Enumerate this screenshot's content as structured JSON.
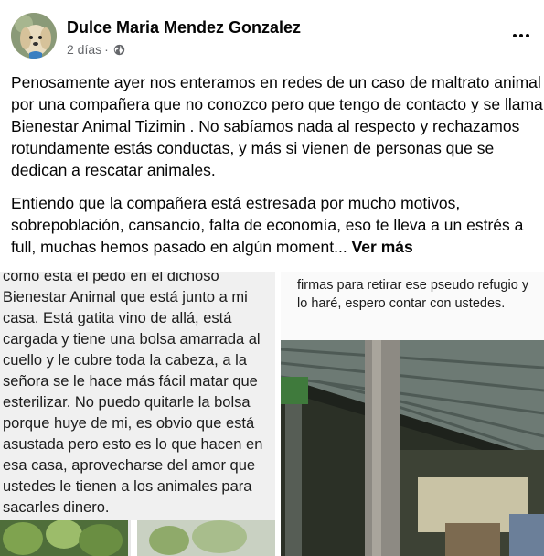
{
  "post": {
    "author": "Dulce Maria Mendez Gonzalez",
    "time": "2 días",
    "separator": "·",
    "privacy_icon": "globe-icon",
    "menu_icon": "more-options-icon",
    "paragraph_1": "Penosamente ayer nos enteramos en redes de un caso de maltrato animal por una compañera que no conozco pero que tengo de contacto y se llama Bienestar Animal Tizimin  . No sabíamos nada al respecto y rechazamos rotundamente estás conductas, y más si vienen de personas que se dedican a rescatar animales.",
    "paragraph_2": "Entiendo que la compañera está estresada por mucho motivos, sobrepoblación, cansancio, falta de economía, eso te lleva a un estrés a full, muchas hemos pasado en algún moment...",
    "see_more": "Ver más"
  },
  "images": {
    "left_text": "como esta el pedo en el dichoso Bienestar Animal que está junto a mi casa. Está gatita vino de allá, está cargada y tiene una bolsa amarrada al cuello y le cubre toda la cabeza, a la señora se le hace más fácil matar que esterilizar. No puedo quitarle la bolsa porque huye de mi, es obvio que está asustada pero esto es lo que hacen en esa casa, aprovecharse del amor que ustedes le tienen a los animales para sacarles dinero.",
    "right_text": "firmas para retirar ese pseudo refugio y lo haré, espero contar con ustedes."
  }
}
